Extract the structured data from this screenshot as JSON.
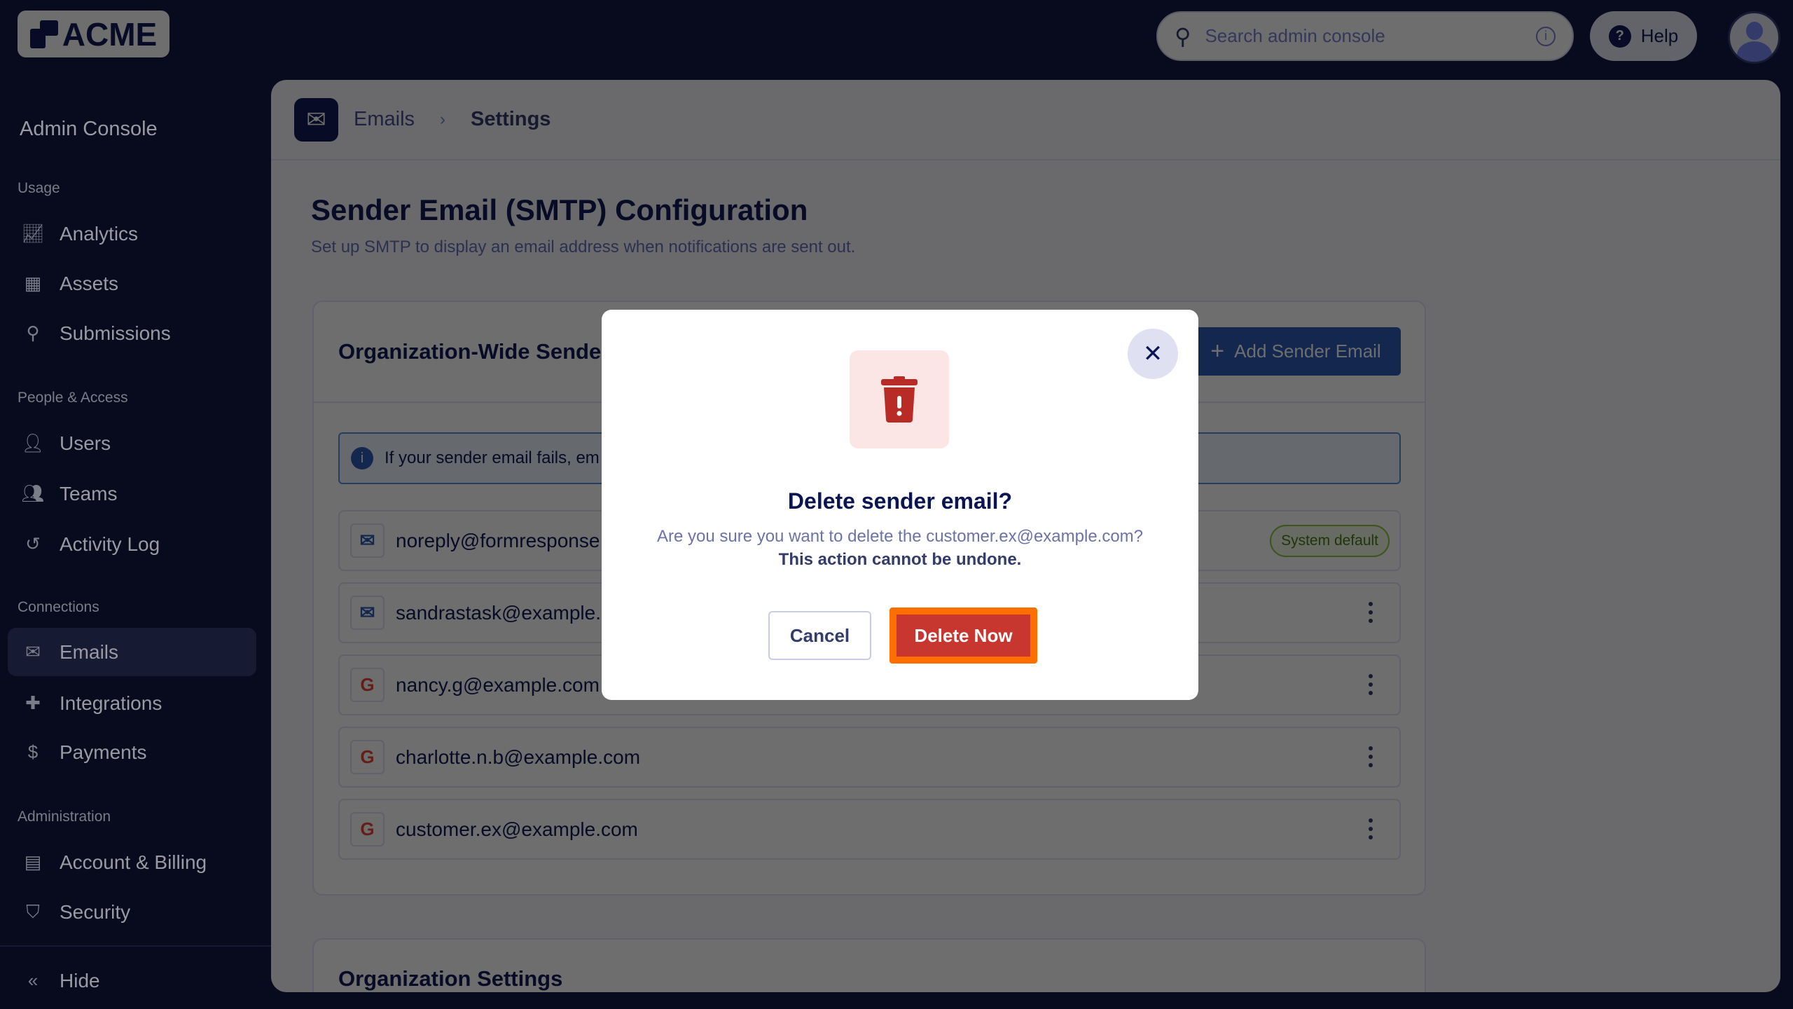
{
  "brand": {
    "logo_text": "ACME"
  },
  "sidebar": {
    "title": "Admin Console",
    "sections": [
      {
        "label": "Usage",
        "items": [
          {
            "label": "Analytics",
            "icon": "chart-icon"
          },
          {
            "label": "Assets",
            "icon": "grid-icon"
          },
          {
            "label": "Submissions",
            "icon": "search-icon"
          }
        ]
      },
      {
        "label": "People & Access",
        "items": [
          {
            "label": "Users",
            "icon": "user-icon"
          },
          {
            "label": "Teams",
            "icon": "team-icon"
          },
          {
            "label": "Activity Log",
            "icon": "history-icon"
          }
        ]
      },
      {
        "label": "Connections",
        "items": [
          {
            "label": "Emails",
            "icon": "mail-icon",
            "active": true
          },
          {
            "label": "Integrations",
            "icon": "puzzle-icon"
          },
          {
            "label": "Payments",
            "icon": "payment-icon"
          }
        ]
      },
      {
        "label": "Administration",
        "items": [
          {
            "label": "Account & Billing",
            "icon": "card-icon"
          },
          {
            "label": "Security",
            "icon": "shield-icon"
          }
        ]
      }
    ],
    "hide_label": "Hide"
  },
  "topbar": {
    "search_placeholder": "Search admin console",
    "help_label": "Help"
  },
  "breadcrumb": {
    "parent": "Emails",
    "current": "Settings"
  },
  "page": {
    "title": "Sender Email (SMTP) Configuration",
    "subtitle": "Set up SMTP to display an email address when notifications are sent out."
  },
  "sender_card": {
    "title": "Organization-Wide Sende",
    "add_button": "Add Sender Email",
    "info_text": "If your sender email fails, em",
    "rows": [
      {
        "email": "noreply@formresponse",
        "type": "smtp",
        "badge": "System default"
      },
      {
        "email": "sandrastask@example.c",
        "type": "smtp"
      },
      {
        "email": "nancy.g@example.com",
        "type": "google"
      },
      {
        "email": "charlotte.n.b@example.com",
        "type": "google"
      },
      {
        "email": "customer.ex@example.com",
        "type": "google"
      }
    ]
  },
  "settings_card": {
    "title": "Organization Settings"
  },
  "modal": {
    "title": "Delete sender email?",
    "message": "Are you sure you want to delete the customer.ex@example.com?",
    "warning": "This action cannot be undone.",
    "cancel": "Cancel",
    "confirm": "Delete Now"
  },
  "colors": {
    "navy": "#0a1551",
    "danger": "#c8372f",
    "highlight": "#ff6f00",
    "primary": "#2e5bb8"
  }
}
